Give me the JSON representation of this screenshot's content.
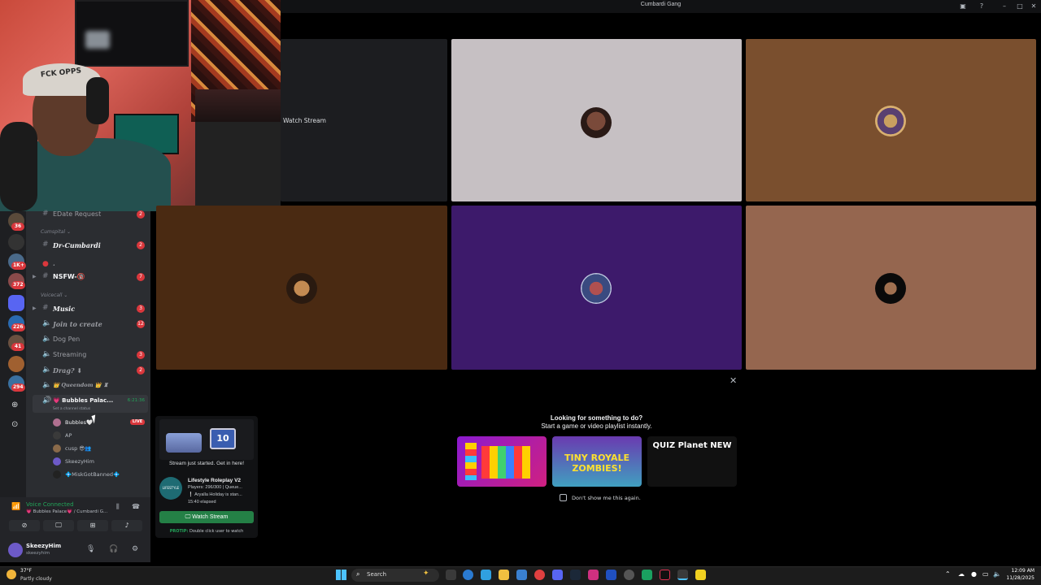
{
  "window": {
    "title": "Cumbardi Gang"
  },
  "watch_stream_tooltip": "Watch Stream",
  "webcam": {
    "cap_text": "FCK OPPS"
  },
  "guild_badges": [
    "36",
    "1K+",
    "372",
    "226",
    "41",
    "294"
  ],
  "channels": [
    {
      "kind": "text",
      "name": "EDate Request",
      "badge": "2"
    },
    {
      "kind": "category",
      "name": "Cumspital ⌄"
    },
    {
      "kind": "text",
      "name": "Dr-Cumbardi",
      "badge": "2"
    },
    {
      "kind": "text",
      "name": "·",
      "badge": ""
    },
    {
      "kind": "text",
      "name": "NSFW-🔞",
      "badge": "7"
    },
    {
      "kind": "category",
      "name": "Voicecall ⌄"
    },
    {
      "kind": "text",
      "name": "Music",
      "badge": "3"
    },
    {
      "kind": "voice",
      "name": "Join to create",
      "badge": "12"
    },
    {
      "kind": "voice",
      "name": "Dog Pen",
      "badge": ""
    },
    {
      "kind": "voice",
      "name": "Streaming",
      "badge": "3"
    },
    {
      "kind": "voice",
      "name": "Drag? ⬇",
      "badge": "2"
    },
    {
      "kind": "voice",
      "name": "👑 Queendom 👑 ♜",
      "badge": ""
    }
  ],
  "active_voice": {
    "name": "💗 Bubbles Palac...",
    "timer": "6:21:36",
    "status": "Set a channel status"
  },
  "voice_users": [
    "Bubbles🤍",
    "AP",
    "cusp 😎👥",
    "SkeezyHim",
    "💠MiskGotBanned💠"
  ],
  "live_label": "LIVE",
  "voice_connected": {
    "title": "Voice Connected",
    "subtitle": "💗 Bubbles Palace💗 / Cumbardi G..."
  },
  "user_panel": {
    "name": "SkeezyHim",
    "tag": "skeezyhim"
  },
  "activity_panel": {
    "title": "Looking for something to do?",
    "subtitle": "Start a game or video playlist instantly.",
    "games": [
      "",
      "TINY ROYALE ZOMBIES!",
      "QUIZ Planet NEW"
    ],
    "dont_show": "Don't show me this again."
  },
  "stream_popup": {
    "tv_number": "10",
    "headline": "Stream just started. Get in here!",
    "logo_text": "LIFESTYLE",
    "game_name": "Lifestyle Roleplay V2",
    "line1": "Players: 296/300 | Queue...",
    "line2": "❕ Aryalla Holiday is stan...",
    "line3": "15:40 elapsed",
    "button": "🖵 Watch Stream",
    "tip_label": "PROTIP:",
    "tip_text": "Double click user to watch"
  },
  "taskbar": {
    "weather_temp": "37°F",
    "weather_desc": "Partly cloudy",
    "search_placeholder": "Search",
    "time": "12:09 AM",
    "date": "11/28/2025"
  },
  "colors": {
    "tile_gray": "#c6c0c3",
    "tile_brown_light": "#7a4f2e",
    "tile_brown_dark": "#4a2a12",
    "tile_purple": "#3d1a6b",
    "tile_tan": "#95664f",
    "discord_green": "#23a55a",
    "badge_red": "#da373c"
  }
}
